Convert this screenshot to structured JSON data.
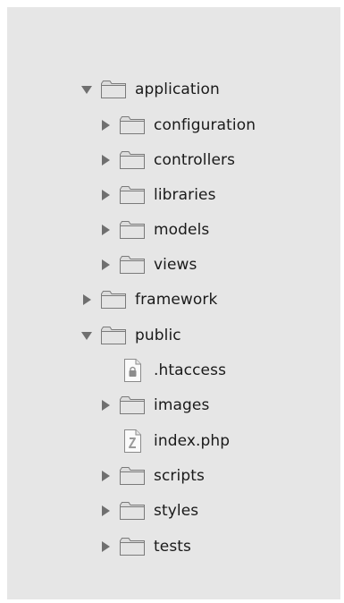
{
  "tree": {
    "items": [
      {
        "label": "application",
        "type": "folder",
        "expanded": true
      },
      {
        "label": "configuration",
        "type": "folder",
        "expanded": false
      },
      {
        "label": "controllers",
        "type": "folder",
        "expanded": false
      },
      {
        "label": "libraries",
        "type": "folder",
        "expanded": false
      },
      {
        "label": "models",
        "type": "folder",
        "expanded": false
      },
      {
        "label": "views",
        "type": "folder",
        "expanded": false
      },
      {
        "label": "framework",
        "type": "folder",
        "expanded": false
      },
      {
        "label": "public",
        "type": "folder",
        "expanded": true
      },
      {
        "label": ".htaccess",
        "type": "file",
        "icon": "locked-file-icon"
      },
      {
        "label": "images",
        "type": "folder",
        "expanded": false
      },
      {
        "label": "index.php",
        "type": "file",
        "icon": "php-file-icon"
      },
      {
        "label": "scripts",
        "type": "folder",
        "expanded": false
      },
      {
        "label": "styles",
        "type": "folder",
        "expanded": false
      },
      {
        "label": "tests",
        "type": "folder",
        "expanded": false
      }
    ]
  },
  "colors": {
    "panel_background": "#e6e6e6",
    "triangle": "#6f6f6f",
    "folder_body": "#dcdcdc",
    "folder_stroke": "#7a7a7a"
  }
}
